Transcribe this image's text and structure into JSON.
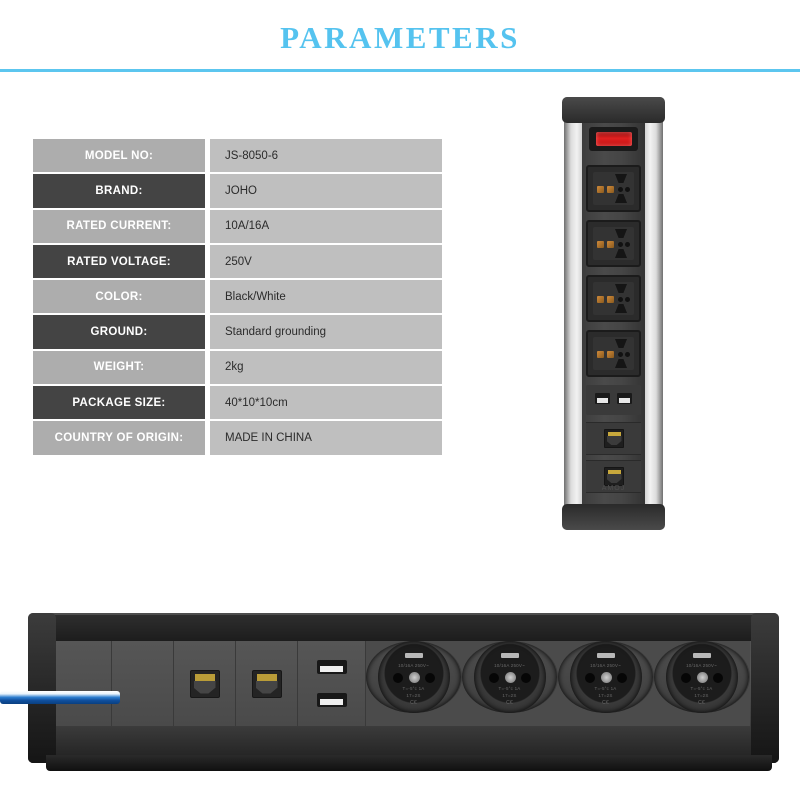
{
  "header": {
    "title": "PARAMETERS",
    "accent_color": "#5cc6ef"
  },
  "spec_table": {
    "rows": [
      {
        "label": "MODEL NO:",
        "value": "JS-8050-6",
        "tone": "light"
      },
      {
        "label": "BRAND:",
        "value": "JOHO",
        "tone": "dark"
      },
      {
        "label": "RATED CURRENT:",
        "value": "10A/16A",
        "tone": "light"
      },
      {
        "label": "RATED VOLTAGE:",
        "value": "250V",
        "tone": "dark"
      },
      {
        "label": "COLOR:",
        "value": "Black/White",
        "tone": "light"
      },
      {
        "label": "GROUND:",
        "value": "Standard grounding",
        "tone": "dark"
      },
      {
        "label": "WEIGHT:",
        "value": "2kg",
        "tone": "light"
      },
      {
        "label": "PACKAGE SIZE:",
        "value": "40*10*10cm",
        "tone": "dark"
      },
      {
        "label": "COUNTRY OF ORIGIN:",
        "value": "MADE IN CHINA",
        "tone": "light"
      }
    ],
    "label_bg_light": "#adadad",
    "label_bg_dark": "#444444",
    "value_bg": "#bfbfbf"
  },
  "vertical_unit": {
    "brand_mark": "AMOJ",
    "switch_color": "#e02020",
    "modules": [
      "power-switch",
      "universal-socket",
      "universal-socket",
      "universal-socket",
      "universal-socket",
      "usb-ports",
      "rj45-jack",
      "rj45-jack"
    ]
  },
  "horizontal_strip": {
    "panels": [
      "blank-panel",
      "blank-panel",
      "rj45-panel",
      "rj45-panel",
      "usb-panel",
      "schuko-socket",
      "schuko-socket",
      "schuko-socket",
      "schuko-socket"
    ],
    "socket_markings": {
      "line1": "10/16A 250V~",
      "line2": "T=-5°c  1A",
      "line3": "17=2S",
      "line4": "C€"
    },
    "cable_color": "#0f4f9e"
  }
}
